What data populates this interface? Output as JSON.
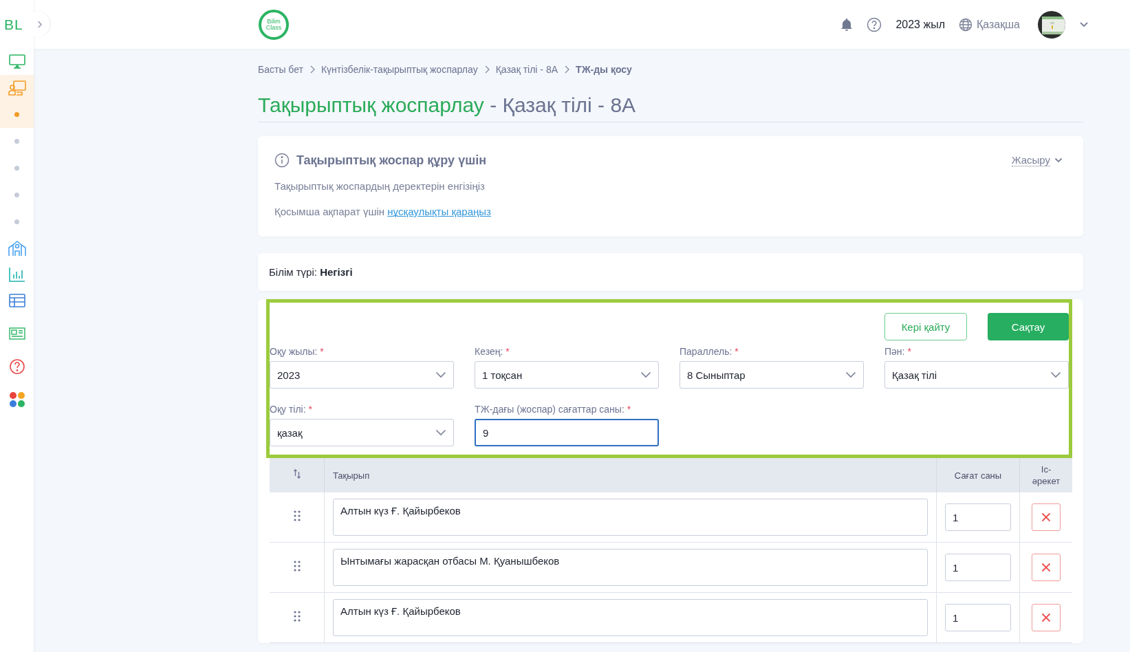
{
  "sidebar": {
    "logo": "BL",
    "expand_icon": "›",
    "top_items": [
      {
        "selected": false
      },
      {
        "selected": true
      }
    ],
    "sub_items": [
      {
        "selected": true
      },
      {
        "selected": false
      },
      {
        "selected": false
      },
      {
        "selected": false
      },
      {
        "selected": false
      }
    ],
    "bottom_items": [
      {
        "selected": false
      },
      {
        "selected": false
      },
      {
        "selected": false
      },
      {
        "selected": false
      },
      {
        "selected": false
      },
      {
        "selected": false
      }
    ]
  },
  "header": {
    "logo_text": [
      "Bilim",
      "Class"
    ],
    "year": "2023 жыл",
    "language": "Қазақша"
  },
  "breadcrumbs": [
    {
      "label": "Басты бет",
      "current": false
    },
    {
      "label": "Күнтізбелік-тақырыптық жоспарлау",
      "current": false
    },
    {
      "label": "Қазақ тілі - 8А",
      "current": false
    },
    {
      "label": "ТЖ-ды қосу",
      "current": true
    }
  ],
  "title": {
    "main": "Тақырыптық жоспарлау",
    "rest": "- Қазақ тілі - 8А"
  },
  "info": {
    "heading": "Тақырыптық жоспар құру үшін",
    "toggle": "Жасыру",
    "line_1": "Тақырыптық жоспардың деректерін енгізіңіз",
    "line_2": "Қосымша ақпарат үшін",
    "link": "нұсқаулықты қараңыз"
  },
  "education": {
    "label": "Білім түрі:",
    "value": "Негізгі"
  },
  "form": {
    "highlighted": true,
    "buttons": [
      {
        "label": "Кері қайту",
        "kind": "outline"
      },
      {
        "label": "Сақтау",
        "kind": "primary"
      }
    ],
    "fields": [
      {
        "kind": "select",
        "label": "Оқу жылы:",
        "required_mark": "*",
        "value": "2023",
        "focused": false
      },
      {
        "kind": "select",
        "label": "Кезең:",
        "required_mark": "*",
        "value": "1 тоқсан",
        "focused": false
      },
      {
        "kind": "select",
        "label": "Параллель:",
        "required_mark": "*",
        "value": "8 Сыныптар",
        "focused": false
      },
      {
        "kind": "select",
        "label": "Пән:",
        "required_mark": "*",
        "value": "Қазақ тілі",
        "focused": false
      },
      {
        "kind": "select",
        "label": "Оқу тілі:",
        "required_mark": "*",
        "value": "қазақ",
        "focused": false
      },
      {
        "kind": "input",
        "label": "ТЖ-дағы (жоспар) сағаттар саны:",
        "required_mark": "*",
        "value": "9",
        "focused": true
      }
    ]
  },
  "table": {
    "columns": [
      "Тақырып",
      "Сағат саны",
      "Іс-әрекет"
    ],
    "rows": [
      {
        "topic": "Алтын күз Ғ. Қайырбеков",
        "hours": "1"
      },
      {
        "topic": "Ынтымағы жарасқан отбасы М. Қуанышбеков",
        "hours": "1"
      },
      {
        "topic": "Алтын күз Ғ. Қайырбеков",
        "hours": "1"
      }
    ]
  }
}
